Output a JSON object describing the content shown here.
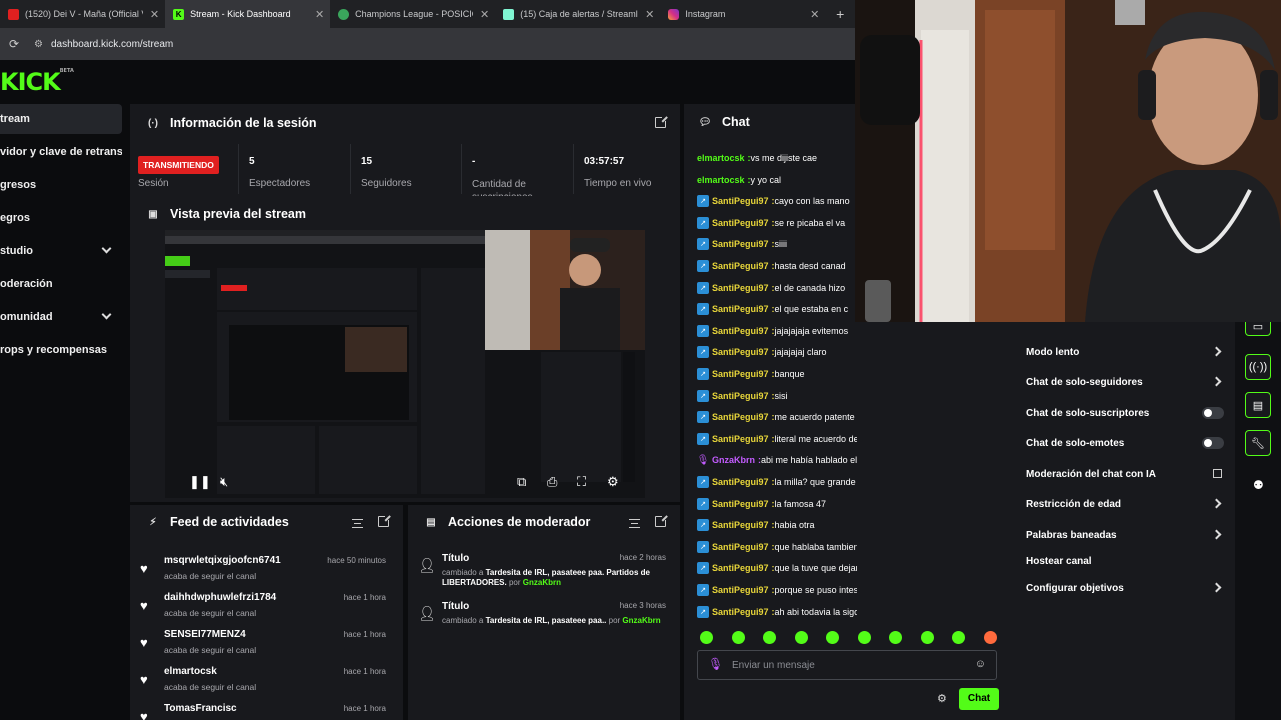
{
  "browser": {
    "tabs": [
      {
        "label": "(1520) Dei V - Maña (Official V",
        "active": false
      },
      {
        "label": "Stream - Kick Dashboard",
        "active": true
      },
      {
        "label": "Champions League - POSICION",
        "active": false
      },
      {
        "label": "(15) Caja de alertas / Streamlab",
        "active": false
      },
      {
        "label": "Instagram",
        "active": false
      }
    ],
    "new_tab": "+",
    "url": "dashboard.kick.com/stream"
  },
  "app": {
    "logo": "KICK",
    "logo_tag": "BETA",
    "colors": {
      "accent": "#53fc18",
      "live": "#e02020",
      "panel": "#18191d",
      "background": "#0b0c0e",
      "badge": "#2b8fd6"
    }
  },
  "sidebar": {
    "items": [
      {
        "label": "tream",
        "active": true,
        "expandable": false
      },
      {
        "label": "vidor y clave de retransm",
        "active": false,
        "expandable": false
      },
      {
        "label": "gresos",
        "active": false,
        "expandable": false
      },
      {
        "label": "egros",
        "active": false,
        "expandable": false
      },
      {
        "label": "studio",
        "active": false,
        "expandable": true
      },
      {
        "label": "oderación",
        "active": false,
        "expandable": false
      },
      {
        "label": "omunidad",
        "active": false,
        "expandable": true
      },
      {
        "label": "rops y recompensas",
        "active": false,
        "expandable": false
      }
    ]
  },
  "session": {
    "title": "Información de la sesión",
    "live_badge": "TRANSMITIENDO",
    "live_label": "Sesión",
    "stats": [
      {
        "value": "5",
        "label": "Espectadores"
      },
      {
        "value": "15",
        "label": "Seguidores"
      },
      {
        "value": "-",
        "label": "Cantidad de suscripciones"
      },
      {
        "value": "03:57:57",
        "label": "Tiempo en vivo"
      }
    ]
  },
  "preview": {
    "title": "Vista previa del stream",
    "controls": [
      "pause-icon",
      "mute-icon",
      "pip-icon",
      "clip-icon",
      "fullscreen-icon",
      "gear-icon"
    ]
  },
  "feed": {
    "title": "Feed de actividades",
    "items": [
      {
        "name": "msqrwletqixgjoofcn6741",
        "time": "hace 50 minutos",
        "action": "acaba de seguir el canal"
      },
      {
        "name": "daihhdwphuwlefrzi1784",
        "time": "hace 1 hora",
        "action": "acaba de seguir el canal"
      },
      {
        "name": "SENSEI77MENZ4",
        "time": "hace 1 hora",
        "action": "acaba de seguir el canal"
      },
      {
        "name": "elmartocsk",
        "time": "hace 1 hora",
        "action": "acaba de seguir el canal"
      },
      {
        "name": "TomasFrancisc",
        "time": "hace 1 hora",
        "action": ""
      }
    ]
  },
  "mod_actions": {
    "title": "Acciones de moderador",
    "items": [
      {
        "title": "Título",
        "time": "hace 2 horas",
        "prefix": "cambiado a",
        "value": "Tardesita de IRL, pasateee paa. Partidos de LIBERTADORES.",
        "by": "por",
        "mod": "GnzaKbrn"
      },
      {
        "title": "Título",
        "time": "hace 3 horas",
        "prefix": "cambiado a",
        "value": "Tardesita de IRL, pasateee paa..",
        "by": "por",
        "mod": "GnzaKbrn"
      }
    ]
  },
  "chat": {
    "title": "Chat",
    "messages": [
      {
        "user": "elmartocsk",
        "text": "vs me dijiste cae",
        "color": "#53fc18",
        "badge": "none"
      },
      {
        "user": "elmartocsk",
        "text": "y yo cal",
        "color": "#53fc18",
        "badge": "none"
      },
      {
        "user": "SantiPegui97",
        "text": "cayo con las mano",
        "color": "#e8d63a",
        "badge": "blue"
      },
      {
        "user": "SantiPegui97",
        "text": "se re picaba el va",
        "color": "#e8d63a",
        "badge": "blue"
      },
      {
        "user": "SantiPegui97",
        "text": "siiii",
        "color": "#e8d63a",
        "badge": "blue"
      },
      {
        "user": "SantiPegui97",
        "text": "hasta desd canad",
        "color": "#e8d63a",
        "badge": "blue"
      },
      {
        "user": "SantiPegui97",
        "text": "el de canada hizo",
        "color": "#e8d63a",
        "badge": "blue"
      },
      {
        "user": "SantiPegui97",
        "text": "el que estaba en c",
        "color": "#e8d63a",
        "badge": "blue"
      },
      {
        "user": "SantiPegui97",
        "text": "jajajajaja evitemos",
        "color": "#e8d63a",
        "badge": "blue"
      },
      {
        "user": "SantiPegui97",
        "text": "jajajajaj claro",
        "color": "#e8d63a",
        "badge": "blue"
      },
      {
        "user": "SantiPegui97",
        "text": "banque",
        "color": "#e8d63a",
        "badge": "blue"
      },
      {
        "user": "SantiPegui97",
        "text": "sisi",
        "color": "#e8d63a",
        "badge": "blue"
      },
      {
        "user": "SantiPegui97",
        "text": "me acuerdo patente",
        "color": "#e8d63a",
        "badge": "blue"
      },
      {
        "user": "SantiPegui97",
        "text": "literal me acuerdo de todo",
        "color": "#e8d63a",
        "badge": "blue"
      },
      {
        "user": "GnzaKbrn",
        "text": "abi me había hablado el otro dia",
        "color": "#c35cff",
        "badge": "mic"
      },
      {
        "user": "SantiPegui97",
        "text": "la milla? que grande",
        "color": "#e8d63a",
        "badge": "blue"
      },
      {
        "user": "SantiPegui97",
        "text": "la famosa 47",
        "color": "#e8d63a",
        "badge": "blue"
      },
      {
        "user": "SantiPegui97",
        "text": "habia otra",
        "color": "#e8d63a",
        "badge": "blue"
      },
      {
        "user": "SantiPegui97",
        "text": "que hablaba tambien alla",
        "color": "#e8d63a",
        "badge": "blue"
      },
      {
        "user": "SantiPegui97",
        "text": "que la tuve que dejar de seguir",
        "color": "#e8d63a",
        "badge": "blue"
      },
      {
        "user": "SantiPegui97",
        "text": "porque se puso inteso todo",
        "color": "#e8d63a",
        "badge": "blue"
      },
      {
        "user": "SantiPegui97",
        "text": "ah abi todavia la sigo ,es crack",
        "color": "#e8d63a",
        "badge": "blue"
      }
    ],
    "input_placeholder": "Enviar un mensaje",
    "send_label": "Chat"
  },
  "chat_settings": {
    "items": [
      {
        "label": "Modo lento",
        "control": "arrow"
      },
      {
        "label": "Chat de solo-seguidores",
        "control": "arrow"
      },
      {
        "label": "Chat de solo-suscriptores",
        "control": "toggle"
      },
      {
        "label": "Chat de solo-emotes",
        "control": "toggle"
      },
      {
        "label": "Moderación del chat con IA",
        "control": "external"
      },
      {
        "label": "Restricción de edad",
        "control": "arrow"
      },
      {
        "label": "Palabras baneadas",
        "control": "arrow"
      },
      {
        "label": "Hostear canal",
        "control": "none"
      },
      {
        "label": "Configurar objetivos",
        "control": "arrow"
      }
    ]
  },
  "rail": {
    "icons": [
      "chat-bubble-icon",
      "broadcast-icon",
      "card-icon",
      "wrench-icon",
      "users-icon"
    ]
  }
}
